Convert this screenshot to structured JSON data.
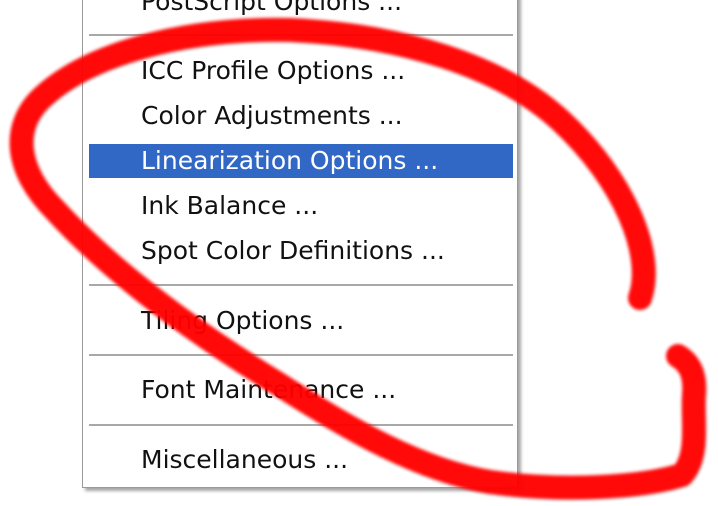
{
  "menu": {
    "items_top": [
      {
        "label": "PostScript Options ..."
      }
    ],
    "items_middle": [
      {
        "label": "ICC Profile Options ..."
      },
      {
        "label": "Color Adjustments ..."
      },
      {
        "label": "Linearization Options ...",
        "highlighted": true
      },
      {
        "label": "Ink Balance ..."
      },
      {
        "label": "Spot Color Definitions ..."
      }
    ],
    "tiling": {
      "label": "Tiling Options ..."
    },
    "font": {
      "label": "Font Maintenance ..."
    },
    "misc": {
      "label": "Miscellaneous ..."
    }
  },
  "colors": {
    "highlight": "#3167c5",
    "annotation": "#ff0000"
  }
}
